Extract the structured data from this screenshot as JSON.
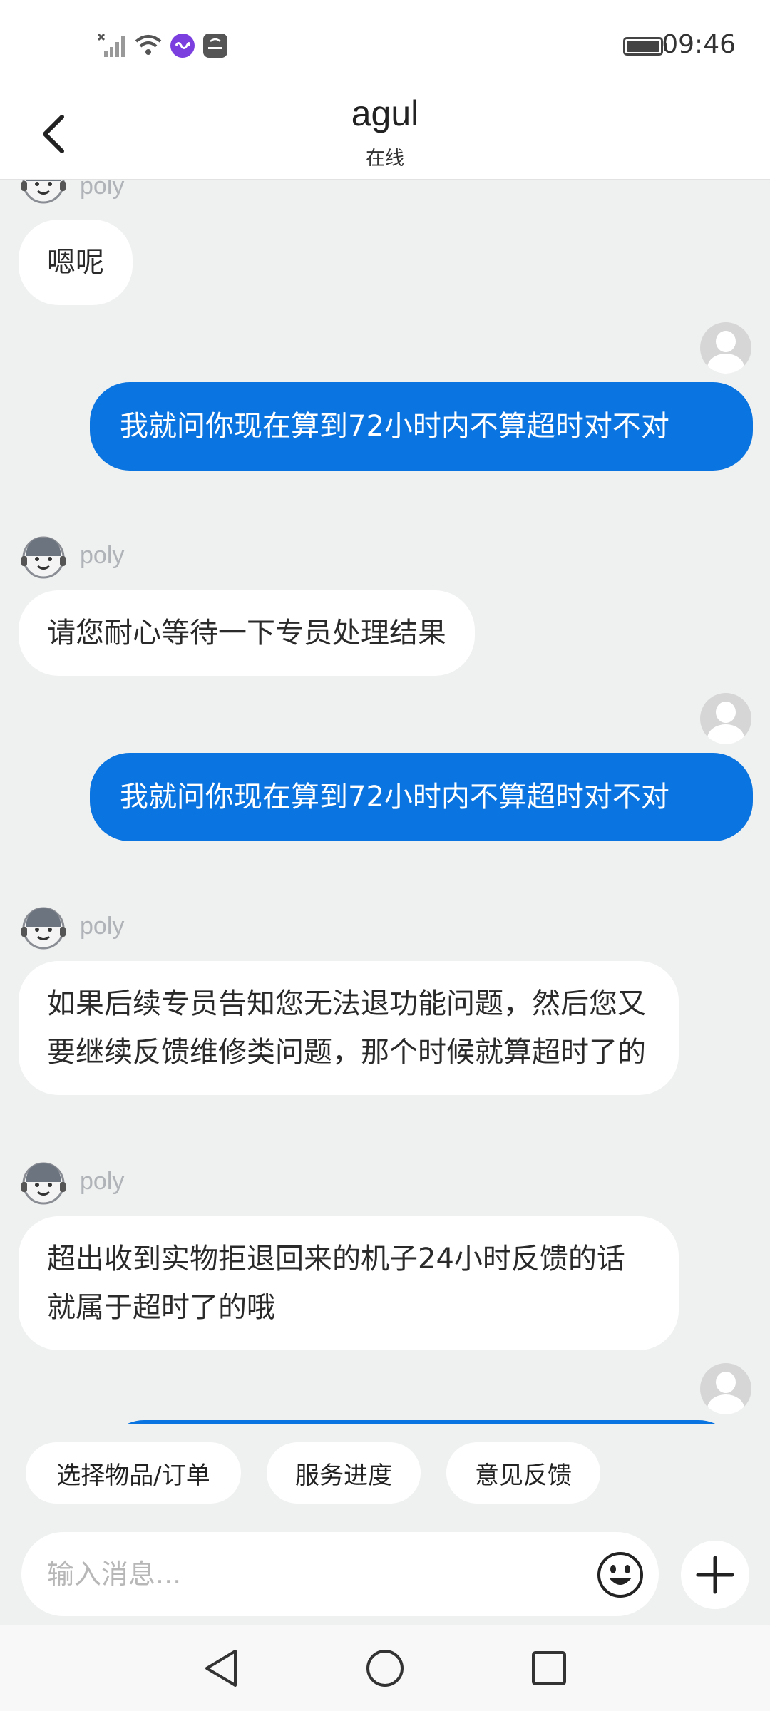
{
  "status_bar": {
    "time": "09:46",
    "icons": [
      "no-signal-icon",
      "wifi-icon",
      "link-app-icon",
      "huawei-app-icon",
      "battery-icon"
    ]
  },
  "header": {
    "title": "agul",
    "subtitle": "在线"
  },
  "messages": [
    {
      "from": "agent",
      "name": "poly",
      "text": "嗯呢"
    },
    {
      "from": "user",
      "text": "我就问你现在算到72小时内不算超时对不对"
    },
    {
      "from": "agent",
      "name": "poly",
      "text": "请您耐心等待一下专员处理结果"
    },
    {
      "from": "user",
      "text": "我就问你现在算到72小时内不算超时对不对"
    },
    {
      "from": "agent",
      "name": "poly",
      "text": "如果后续专员告知您无法退功能问题，然后您又要继续反馈维修类问题，那个时候就算超时了的"
    },
    {
      "from": "agent",
      "name": "poly",
      "text": "超出收到实物拒退回来的机子24小时反馈的话就属于超时了的哦"
    }
  ],
  "quick_actions": [
    "选择物品/订单",
    "服务进度",
    "意见反馈"
  ],
  "input": {
    "placeholder": "输入消息..."
  },
  "colors": {
    "user_bubble": "#0a74e0",
    "background": "#eff0f0",
    "agent_bubble": "#ffffff"
  }
}
